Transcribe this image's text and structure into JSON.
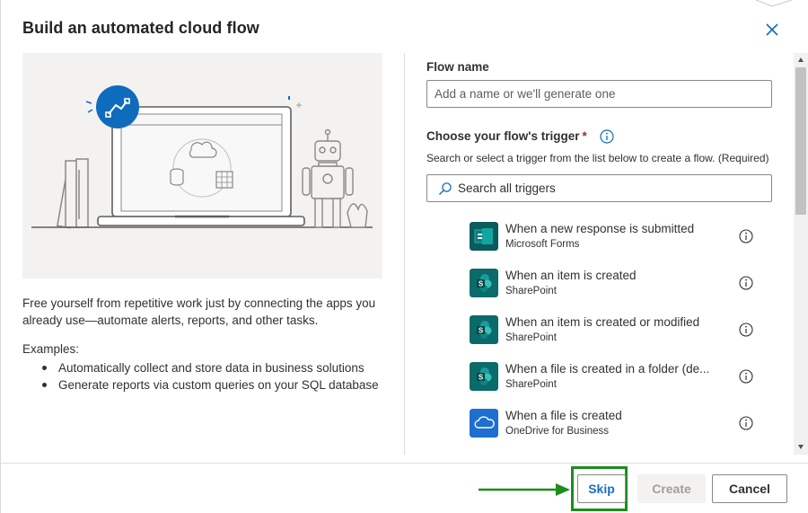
{
  "dialog": {
    "title": "Build an automated cloud flow"
  },
  "left": {
    "description": "Free yourself from repetitive work just by connecting the apps you already use—automate alerts, reports, and other tasks.",
    "examples_label": "Examples:",
    "examples": [
      "Automatically collect and store data in business solutions",
      "Generate reports via custom queries on your SQL database"
    ]
  },
  "form": {
    "flow_name_label": "Flow name",
    "flow_name_placeholder": "Add a name or we'll generate one",
    "flow_name_value": "",
    "trigger_label": "Choose your flow's trigger",
    "required_mark": "*",
    "trigger_helper": "Search or select a trigger from the list below to create a flow. (Required)",
    "search_placeholder": "Search all triggers"
  },
  "triggers": [
    {
      "title": "When a new response is submitted",
      "app": "Microsoft Forms",
      "icon": "forms-icon",
      "color": "#0b5a5e"
    },
    {
      "title": "When an item is created",
      "app": "SharePoint",
      "icon": "sharepoint-icon",
      "color": "#0b6a6a"
    },
    {
      "title": "When an item is created or modified",
      "app": "SharePoint",
      "icon": "sharepoint-icon",
      "color": "#0b6a6a"
    },
    {
      "title": "When a file is created in a folder (de...",
      "app": "SharePoint",
      "icon": "sharepoint-icon",
      "color": "#0b6a6a"
    },
    {
      "title": "When a file is created",
      "app": "OneDrive for Business",
      "icon": "onedrive-icon",
      "color": "#1e6fd0"
    }
  ],
  "footer": {
    "skip_label": "Skip",
    "create_label": "Create",
    "cancel_label": "Cancel"
  },
  "colors": {
    "accent": "#0f6cbd",
    "highlight": "#1e8c1e",
    "sharepoint": "#0b6a6a",
    "onedrive": "#1e6fd0"
  }
}
